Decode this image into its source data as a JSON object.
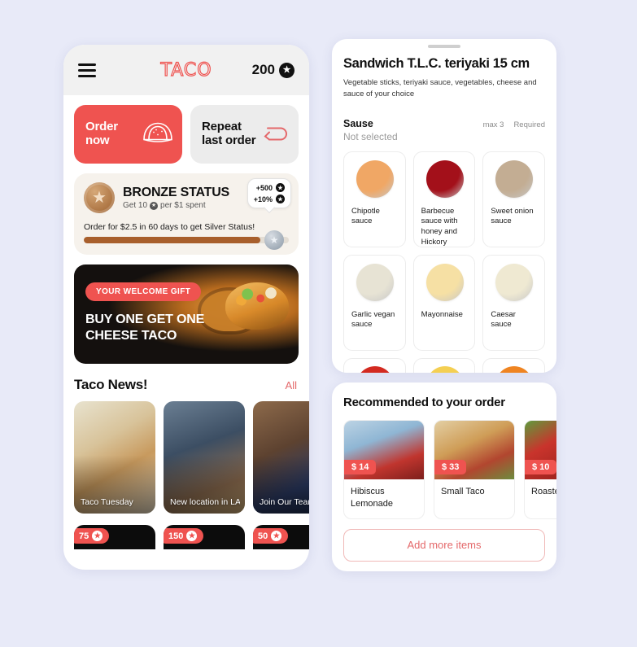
{
  "app": {
    "logo_text": "TACO",
    "points": "200",
    "star_icon": "star-icon",
    "menu_icon": "hamburger-menu-icon"
  },
  "quick_actions": [
    {
      "label_line1": "Order",
      "label_line2": "now",
      "icon": "taco-icon"
    },
    {
      "label_line1": "Repeat",
      "label_line2": "last order",
      "icon": "repeat-arrow-icon"
    }
  ],
  "status": {
    "tier_title": "BRONZE STATUS",
    "earn_prefix": "Get 10",
    "earn_suffix": "per $1 spent",
    "progress_message": "Order for $2.5 in 60 days to get Silver Status!",
    "progress_percent": 86,
    "tooltip": [
      {
        "value": "+500"
      },
      {
        "value": "+10%"
      }
    ],
    "medal_icon": "bronze-medal-icon",
    "next_medal_icon": "silver-medal-icon"
  },
  "promo": {
    "badge": "YOUR WELCOME GIFT",
    "title_line1": "BUY ONE GET ONE",
    "title_line2": "CHEESE TACO"
  },
  "news": {
    "title": "Taco News!",
    "all_link": "All",
    "cards": [
      {
        "caption": "Taco Tuesday"
      },
      {
        "caption": "New location in LA!"
      },
      {
        "caption": "Join Our Team"
      }
    ]
  },
  "offers_peek": [
    {
      "points": "75"
    },
    {
      "points": "150"
    },
    {
      "points": "50"
    }
  ],
  "sauce_sheet": {
    "title": "Sandwich T.L.C. teriyaki 15 cm",
    "description": "Vegetable sticks, teriyaki sauce, vegetables, cheese and sauce of your choice",
    "option_name": "Sause",
    "option_max": "max 3",
    "option_required": "Required",
    "option_state": "Not selected",
    "items": [
      {
        "label": "Chipotle sauce",
        "color": "#f0a765"
      },
      {
        "label": "Barbecue sauce with honey and Hickory",
        "color": "#a3101a"
      },
      {
        "label": "Sweet onion sauce",
        "color": "#c3ad93"
      },
      {
        "label": "Garlic vegan sauce",
        "color": "#e7e3d4"
      },
      {
        "label": "Mayonnaise",
        "color": "#f6e0a4"
      },
      {
        "label": "Caesar sauce",
        "color": "#efe9d2"
      },
      {
        "label": "",
        "color": "#d32a20"
      },
      {
        "label": "",
        "color": "#f4cf52"
      },
      {
        "label": "",
        "color": "#ef8421"
      }
    ]
  },
  "recommend": {
    "title": "Recommended to your order",
    "items": [
      {
        "price": "$ 14",
        "name": "Hibiscus Lemonade"
      },
      {
        "price": "$ 33",
        "name": "Small Taco"
      },
      {
        "price": "$ 10",
        "name": "Roasted Pepper"
      }
    ],
    "add_more_label": "Add more items"
  },
  "colors": {
    "accent": "#ef5350",
    "link": "#e4686a",
    "background": "#e8eaf8",
    "bronze": "#a85f2c"
  }
}
